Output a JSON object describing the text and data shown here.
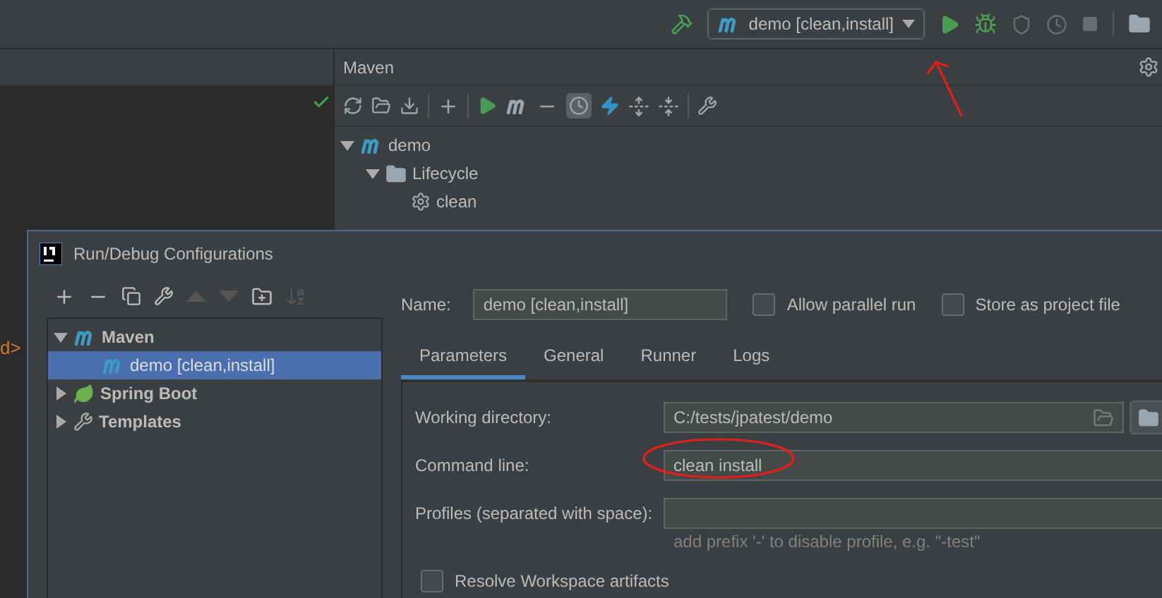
{
  "toolbar": {
    "run_config": "demo [clean,install]"
  },
  "editor": {
    "fragment": "d>"
  },
  "maven": {
    "title": "Maven",
    "offline_toggle_on": true,
    "tree": [
      {
        "label": "demo",
        "kind": "project",
        "expanded": true,
        "children": [
          {
            "label": "Lifecycle",
            "kind": "folder",
            "expanded": true,
            "children": [
              {
                "label": "clean",
                "kind": "goal"
              }
            ]
          }
        ]
      }
    ]
  },
  "dialog": {
    "title": "Run/Debug Configurations",
    "tree": [
      {
        "label": "Maven",
        "kind": "maven",
        "expanded": true,
        "selected": false,
        "children": [
          {
            "label": "demo [clean,install]",
            "kind": "maven",
            "selected": true
          }
        ]
      },
      {
        "label": "Spring Boot",
        "kind": "spring",
        "expanded": false,
        "selected": false
      },
      {
        "label": "Templates",
        "kind": "wrench",
        "expanded": false,
        "selected": false
      }
    ],
    "name_label": "Name:",
    "name_value": "demo [clean,install]",
    "options": [
      {
        "label": "Allow parallel run",
        "checked": false
      },
      {
        "label": "Store as project file",
        "checked": false
      }
    ],
    "tabs": [
      {
        "label": "Parameters",
        "selected": true
      },
      {
        "label": "General",
        "selected": false
      },
      {
        "label": "Runner",
        "selected": false
      },
      {
        "label": "Logs",
        "selected": false
      }
    ],
    "fields": [
      {
        "label": "Working directory:",
        "kind": "directory",
        "value": "C:/tests/jpatest/demo"
      },
      {
        "label": "Command line:",
        "kind": "text",
        "value": "clean install"
      },
      {
        "label": "Profiles (separated with space):",
        "kind": "text",
        "hint": "add prefix '-' to disable profile, e.g. \"-test\""
      }
    ],
    "resolve": {
      "label": "Resolve Workspace artifacts",
      "checked": false
    }
  }
}
